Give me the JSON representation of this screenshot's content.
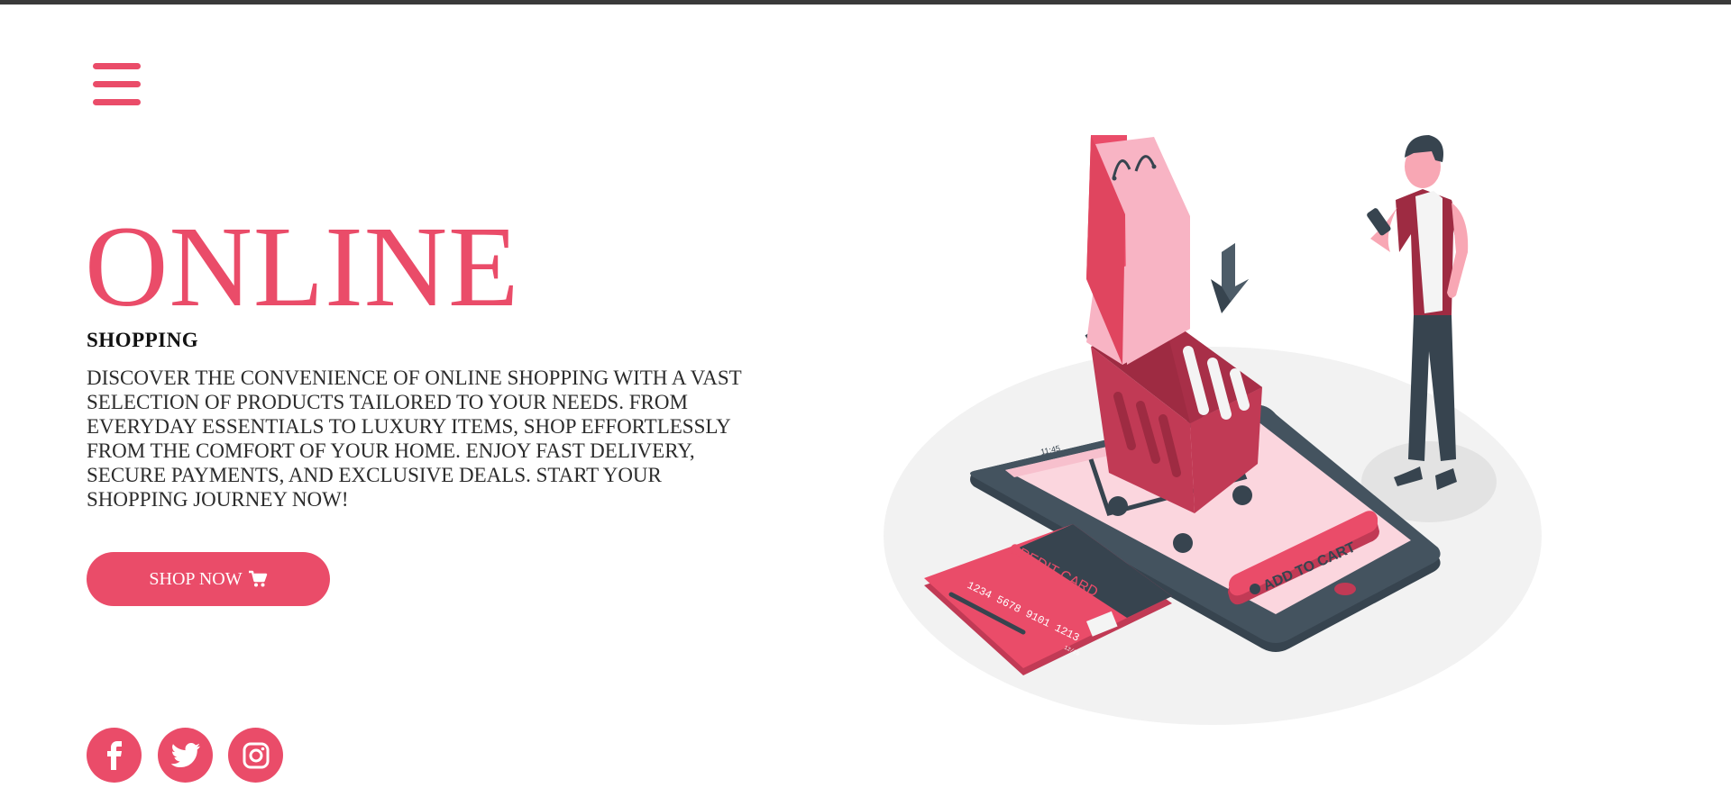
{
  "nav": {
    "menu_icon": "hamburger-menu-icon"
  },
  "hero": {
    "title": "ONLINE",
    "subtitle": "SHOPPING",
    "description": "DISCOVER THE CONVENIENCE OF ONLINE SHOPPING WITH A VAST SELECTION OF PRODUCTS TAILORED TO YOUR NEEDS. FROM EVERYDAY ESSENTIALS TO LUXURY ITEMS, SHOP EFFORTLESSLY FROM THE COMFORT OF YOUR HOME. ENJOY FAST DELIVERY, SECURE PAYMENTS, AND EXCLUSIVE DEALS. START YOUR SHOPPING JOURNEY NOW!",
    "button_label": "SHOP NOW",
    "button_icon": "shopping-cart-icon"
  },
  "social": [
    {
      "name": "facebook",
      "icon": "facebook-icon"
    },
    {
      "name": "twitter",
      "icon": "twitter-icon"
    },
    {
      "name": "instagram",
      "icon": "instagram-icon"
    }
  ],
  "illustration": {
    "credit_card_label": "CREDIT CARD",
    "card_number": "1234 5678 9101 1213",
    "card_expiry": "12/25",
    "phone_button_label": "ADD TO CART",
    "phone_time": "11:45"
  },
  "colors": {
    "accent": "#ea4c69",
    "dark": "#3f4a55",
    "basket": "#c13a55"
  }
}
